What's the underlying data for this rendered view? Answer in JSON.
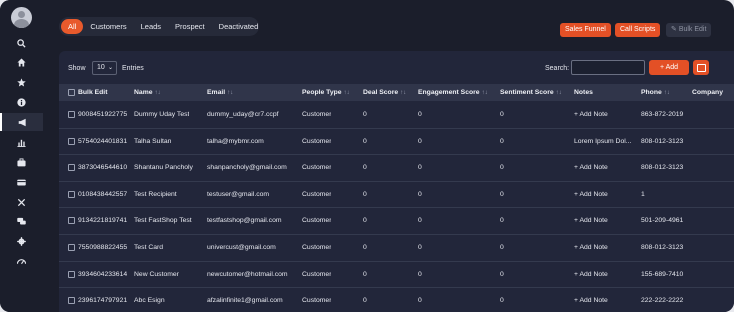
{
  "colors": {
    "accent": "#e35026",
    "background": "#1b1e2b",
    "panel": "#22263a"
  },
  "sidebar": {
    "icons": [
      "avatar",
      "search-icon",
      "home-icon",
      "star-icon",
      "info-icon",
      "megaphone-icon",
      "chart-icon",
      "briefcase-icon",
      "card-icon",
      "tools-icon",
      "chat-icon",
      "gear-icon",
      "speedometer-icon"
    ],
    "active": "megaphone-icon"
  },
  "filters": [
    "All",
    "Customers",
    "Leads",
    "Prospect",
    "Deactivated"
  ],
  "toolbar": {
    "sales_funnel": "Sales Funnel",
    "call_scripts": "Call Scripts",
    "bulk_edit": "Bulk Edit"
  },
  "controls": {
    "show": "Show",
    "page_size": "10",
    "entries": "Entries",
    "search": "Search:",
    "search_value": "",
    "add": "+ Add"
  },
  "table": {
    "headers": [
      "Bulk Edit",
      "Name",
      "Email",
      "People Type",
      "Deal Score",
      "Engagement Score",
      "Sentiment Score",
      "Notes",
      "Phone",
      "Company"
    ],
    "rows": [
      [
        "9008451922775",
        "Dummy Uday Test",
        "dummy_uday@cr7.ccpf",
        "Customer",
        "0",
        "0",
        "0",
        "+ Add Note",
        "863-872-2019"
      ],
      [
        "5754024401831",
        "Talha Sultan",
        "talha@mybmr.com",
        "Customer",
        "0",
        "0",
        "0",
        "Lorem Ipsum Dol...",
        "808-012-3123"
      ],
      [
        "3873046544610",
        "Shantanu Pancholy",
        "shanpancholy@gmail.com",
        "Customer",
        "0",
        "0",
        "0",
        "+ Add Note",
        "808-012-3123"
      ],
      [
        "0108438442557",
        "Test Recipient",
        "testuser@gmail.com",
        "Customer",
        "0",
        "0",
        "0",
        "+ Add Note",
        "1"
      ],
      [
        "9134221819741",
        "Test FastShop Test",
        "testfastshop@gmail.com",
        "Customer",
        "0",
        "0",
        "0",
        "+ Add Note",
        "501-209-4961"
      ],
      [
        "7550988822455",
        "Test Card",
        "univercust@gmail.com",
        "Customer",
        "0",
        "0",
        "0",
        "+ Add Note",
        "808-012-3123"
      ],
      [
        "3934604233614",
        "New Customer",
        "newcutomer@hotmail.com",
        "Customer",
        "0",
        "0",
        "0",
        "+ Add Note",
        "155-689-7410"
      ],
      [
        "2396174797921",
        "Abc Esign",
        "afzalinfinite1@gmail.com",
        "Customer",
        "0",
        "0",
        "0",
        "+ Add Note",
        "222-222-2222"
      ]
    ]
  }
}
